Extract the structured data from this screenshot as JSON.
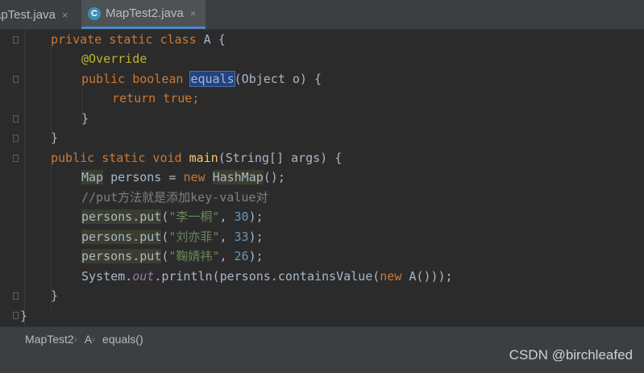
{
  "tabs": [
    {
      "label": "apTest.java",
      "close": "×"
    },
    {
      "label": "MapTest2.java",
      "close": "×",
      "icon": "class-icon",
      "icon_glyph": "C"
    }
  ],
  "code": {
    "l1": {
      "kw": "private static class ",
      "rest": "A {"
    },
    "l2": {
      "ann": "@Override"
    },
    "l3": {
      "kw": "public boolean ",
      "sel": "equals",
      "rest": "(Object o) {"
    },
    "l4": {
      "kw": "return ",
      "rest_kw": "true",
      "rest": ";"
    },
    "l5": {
      "rest": "}"
    },
    "l6": {
      "rest": "}"
    },
    "l7": {
      "kw": "public static void ",
      "fn": "main",
      "rest": "(String[] args) {"
    },
    "l8": {
      "type1": "Map",
      "mid": " persons = ",
      "kw": "new ",
      "type2": "HashMap",
      "rest": "();"
    },
    "l9": {
      "comment": "//put方法就是添加key-value对"
    },
    "l10": {
      "obj": "persons.put",
      "open": "(",
      "str": "\"李一桐\"",
      "comma": ", ",
      "num": "30",
      "close": ");"
    },
    "l11": {
      "obj": "persons.put",
      "open": "(",
      "str": "\"刘亦菲\"",
      "comma": ", ",
      "num": "33",
      "close": ");"
    },
    "l12": {
      "obj": "persons.put",
      "open": "(",
      "str": "\"鞠婧祎\"",
      "comma": ", ",
      "num": "26",
      "close": ");"
    },
    "l13": {
      "a": "System.",
      "out": "out",
      "b": ".println(persons.containsValue(",
      "kw": "new ",
      "c": "A()));"
    },
    "l14": {
      "rest": "}"
    },
    "l15": {
      "rest": "}"
    }
  },
  "breadcrumb": {
    "items": [
      "MapTest2",
      "A",
      "equals()"
    ],
    "separator": "›"
  },
  "watermark": "CSDN @birchleafed"
}
